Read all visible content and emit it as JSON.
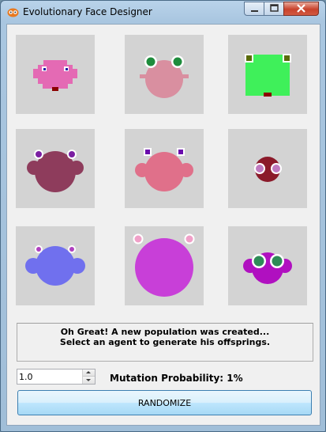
{
  "window": {
    "title": "Evolutionary Face Designer",
    "icon": "owl-face-icon",
    "controls": [
      "minimize-icon",
      "maximize-icon",
      "close-icon"
    ]
  },
  "population_grid": {
    "cell_background": "#d3d3d3",
    "agents": [
      {
        "shape": "square-head",
        "body_color": "#e46ab4",
        "eye_color": "#1a1aa0",
        "mouth_color": "#8b0000"
      },
      {
        "shape": "round-head",
        "body_color": "#d98fa0",
        "eye_color": "#1e8c3c",
        "mouth_color": "none"
      },
      {
        "shape": "square-head",
        "body_color": "#3ff05a",
        "eye_color": "#5a6b0a",
        "mouth_color": "#8b0000"
      },
      {
        "shape": "round-head",
        "body_color": "#8e3c5c",
        "eye_color": "#7b1fa2",
        "mouth_color": "none"
      },
      {
        "shape": "round-head",
        "body_color": "#e0708a",
        "eye_color": "#6a0dad",
        "mouth_color": "none"
      },
      {
        "shape": "small-round-head",
        "body_color": "#8b1a2a",
        "eye_color": "#c07ac0",
        "mouth_color": "none"
      },
      {
        "shape": "round-head",
        "body_color": "#7070ee",
        "eye_color": "#b040c0",
        "mouth_color": "none"
      },
      {
        "shape": "round-head",
        "body_color": "#c83fd8",
        "eye_color": "#f0a0c8",
        "mouth_color": "none"
      },
      {
        "shape": "round-head",
        "body_color": "#b010c0",
        "eye_color": "#2e8b57",
        "mouth_color": "none"
      }
    ]
  },
  "status": {
    "line1": "Oh Great! A new population was created...",
    "line2": "Select an agent to generate his offsprings."
  },
  "mutation": {
    "spinner_value": "1.0",
    "label": "Mutation Probability: 1%"
  },
  "randomize_label": "RANDOMIZE"
}
